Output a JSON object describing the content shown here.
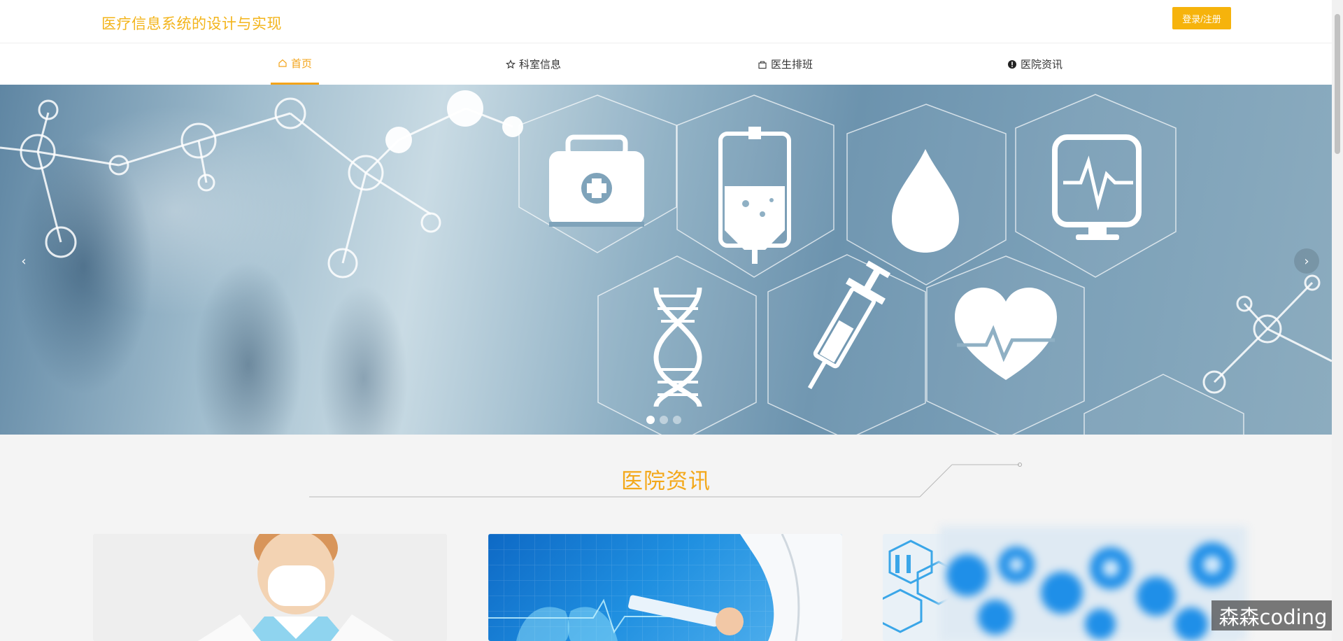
{
  "header": {
    "site_title": "医疗信息系统的设计与实现",
    "login_label": "登录/注册"
  },
  "nav": {
    "items": [
      {
        "label": "首页",
        "icon": "home-icon",
        "active": true
      },
      {
        "label": "科室信息",
        "icon": "star-icon",
        "active": false
      },
      {
        "label": "医生排班",
        "icon": "bag-icon",
        "active": false
      },
      {
        "label": "医院资讯",
        "icon": "info-icon",
        "active": false
      }
    ]
  },
  "banner": {
    "slide_count": 3,
    "active_slide": 1,
    "prev_label": "‹",
    "next_label": "›"
  },
  "news_section": {
    "title": "医院资讯"
  },
  "watermark": "森森coding",
  "colors": {
    "accent": "#f3a81a",
    "login_button": "#f6b30c"
  }
}
